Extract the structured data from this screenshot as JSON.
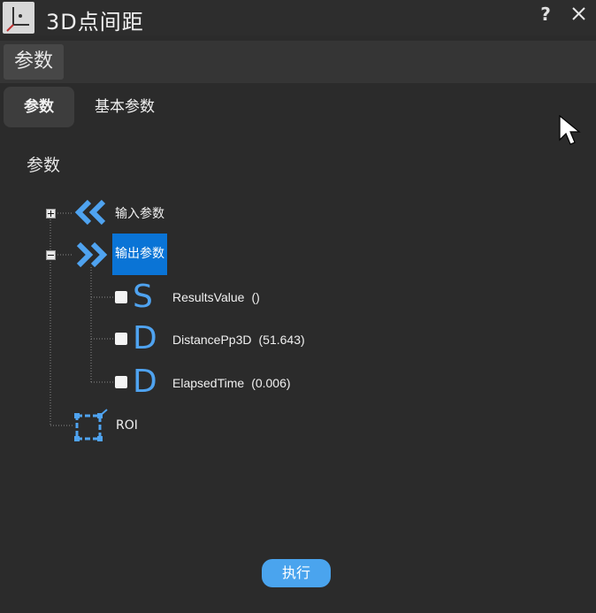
{
  "window": {
    "title": "3D点间距",
    "help_label": "?"
  },
  "section": {
    "label": "参数"
  },
  "tabs": [
    {
      "label": "参数",
      "active": true
    },
    {
      "label": "基本参数",
      "active": false
    }
  ],
  "group": {
    "label": "参数"
  },
  "tree": {
    "input_node": {
      "label": "输入参数",
      "expanded": false
    },
    "output_node": {
      "label": "输出参数",
      "expanded": true,
      "selected": true,
      "items": [
        {
          "type_letter": "S",
          "name": "ResultsValue",
          "value": "()",
          "checked": false
        },
        {
          "type_letter": "D",
          "name": "DistancePp3D",
          "value": "(51.643)",
          "checked": false
        },
        {
          "type_letter": "D",
          "name": "ElapsedTime",
          "value": "(0.006)",
          "checked": false
        }
      ]
    },
    "roi_node": {
      "label": "ROI"
    }
  },
  "actions": {
    "run_label": "执行"
  },
  "colors": {
    "accent": "#4aa4ee",
    "selection": "#0a74d6",
    "icon_blue": "#4fa3f0",
    "background": "#2b2b2b"
  }
}
